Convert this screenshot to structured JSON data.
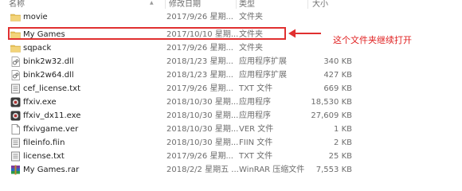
{
  "columns": {
    "name": "名称",
    "date": "修改日期",
    "type": "类型",
    "size": "大小"
  },
  "files": [
    {
      "icon": "folder-icon",
      "name": "movie",
      "date": "2017/9/26 星期...",
      "type": "文件夹",
      "size": ""
    },
    {
      "icon": "folder-icon",
      "name": "My Games",
      "date": "2017/10/10 星期...",
      "type": "文件夹",
      "size": ""
    },
    {
      "icon": "folder-icon",
      "name": "sqpack",
      "date": "2017/9/26 星期...",
      "type": "文件夹",
      "size": ""
    },
    {
      "icon": "dll-icon",
      "name": "bink2w32.dll",
      "date": "2018/1/23 星期...",
      "type": "应用程序扩展",
      "size": "340 KB"
    },
    {
      "icon": "dll-icon",
      "name": "bink2w64.dll",
      "date": "2018/1/23 星期...",
      "type": "应用程序扩展",
      "size": "427 KB"
    },
    {
      "icon": "text-file-icon",
      "name": "cef_license.txt",
      "date": "2017/9/26 星期...",
      "type": "TXT 文件",
      "size": "669 KB"
    },
    {
      "icon": "app-exe-icon",
      "name": "ffxiv.exe",
      "date": "2018/10/30 星期...",
      "type": "应用程序",
      "size": "18,530 KB"
    },
    {
      "icon": "app-exe-icon",
      "name": "ffxiv_dx11.exe",
      "date": "2018/10/30 星期...",
      "type": "应用程序",
      "size": "27,609 KB"
    },
    {
      "icon": "blank-file-icon",
      "name": "ffxivgame.ver",
      "date": "2018/10/30 星期...",
      "type": "VER 文件",
      "size": "1 KB"
    },
    {
      "icon": "text-file-icon",
      "name": "fileinfo.fiin",
      "date": "2018/10/30 星期...",
      "type": "FIIN 文件",
      "size": "2 KB"
    },
    {
      "icon": "text-file-icon",
      "name": "license.txt",
      "date": "2017/9/26 星期...",
      "type": "TXT 文件",
      "size": "25 KB"
    },
    {
      "icon": "winrar-archive-icon",
      "name": "My Games.rar",
      "date": "2018/2/2 星期五 ...",
      "type": "WinRAR 压缩文件",
      "size": "7,553 KB"
    }
  ],
  "annotation": {
    "text": "这个文件夹继续打开",
    "color": "#e02020"
  },
  "colors": {
    "folder": "#e8c25a",
    "annotation_red": "#e03030"
  }
}
